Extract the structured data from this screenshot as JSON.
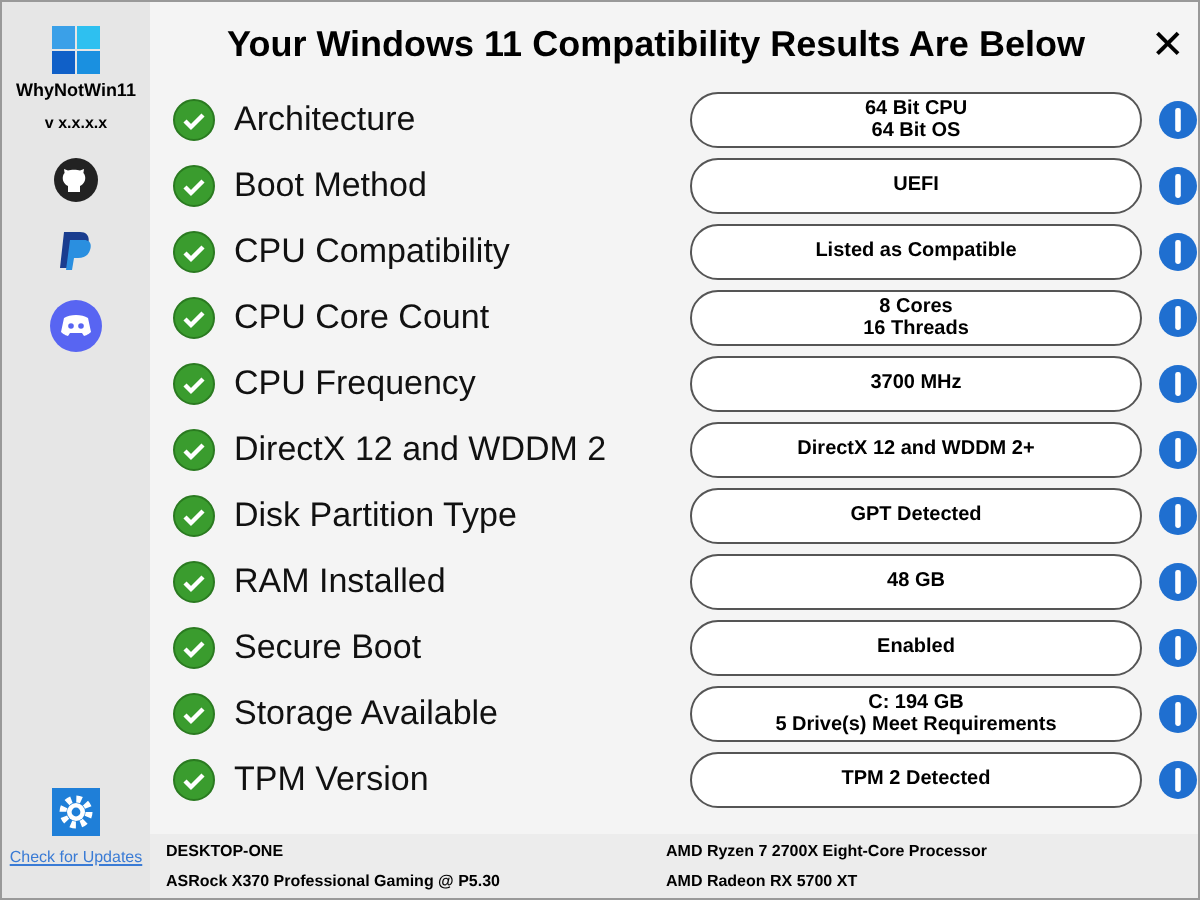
{
  "sidebar": {
    "app_name": "WhyNotWin11",
    "version": "v x.x.x.x",
    "check_updates": "Check for Updates"
  },
  "title": "Your Windows 11 Compatibility Results Are Below",
  "close": "✕",
  "checks": [
    {
      "label": "Architecture",
      "passed": true,
      "result": [
        "64 Bit CPU",
        "64 Bit OS"
      ]
    },
    {
      "label": "Boot Method",
      "passed": true,
      "result": [
        "UEFI"
      ]
    },
    {
      "label": "CPU Compatibility",
      "passed": true,
      "result": [
        "Listed as Compatible"
      ]
    },
    {
      "label": "CPU Core Count",
      "passed": true,
      "result": [
        "8 Cores",
        "16 Threads"
      ]
    },
    {
      "label": "CPU Frequency",
      "passed": true,
      "result": [
        "3700 MHz"
      ]
    },
    {
      "label": "DirectX 12 and WDDM 2",
      "passed": true,
      "result": [
        "DirectX 12 and WDDM 2+"
      ]
    },
    {
      "label": "Disk Partition Type",
      "passed": true,
      "result": [
        "GPT Detected"
      ]
    },
    {
      "label": "RAM Installed",
      "passed": true,
      "result": [
        "48 GB"
      ]
    },
    {
      "label": "Secure Boot",
      "passed": true,
      "result": [
        "Enabled"
      ]
    },
    {
      "label": "Storage Available",
      "passed": true,
      "result": [
        "C: 194 GB",
        "5 Drive(s) Meet Requirements"
      ]
    },
    {
      "label": "TPM Version",
      "passed": true,
      "result": [
        "TPM 2 Detected"
      ]
    }
  ],
  "system_info": [
    "DESKTOP-ONE",
    "AMD Ryzen 7 2700X Eight-Core Processor",
    "ASRock X370 Professional Gaming @ P5.30",
    "AMD Radeon RX 5700 XT"
  ]
}
